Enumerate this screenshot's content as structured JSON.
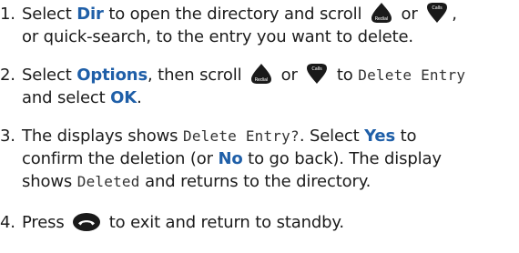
{
  "steps": [
    {
      "number": "1.",
      "text_1": "Select ",
      "key_dir": "Dir",
      "text_2": " to open the directory and scroll ",
      "text_3": " or ",
      "text_4": ",",
      "text_5": "or quick-search, to the entry you want to delete."
    },
    {
      "number": "2.",
      "text_1": "Select ",
      "key_options": "Options",
      "text_2": ", then scroll ",
      "text_3": " or ",
      "text_4": " to ",
      "lcd_delete_entry": "Delete Entry",
      "text_5": "and select ",
      "key_ok": "OK",
      "text_6": "."
    },
    {
      "number": "3.",
      "text_1": "The displays shows ",
      "lcd_delete_entry_q": "Delete Entry?",
      "text_2": ". Select ",
      "key_yes": "Yes",
      "text_3": " to",
      "text_4": "confirm the deletion (or ",
      "key_no": "No",
      "text_5": " to go back). The display",
      "text_6": "shows ",
      "lcd_deleted": "Deleted",
      "text_7": " and returns to the directory."
    },
    {
      "number": "4.",
      "text_1": "Press ",
      "text_2": " to exit and return to standby."
    }
  ],
  "icons": {
    "up_key": "redial-up-icon",
    "up_key_label": "Redial",
    "down_key": "calls-down-icon",
    "down_key_label": "Calls",
    "end_key": "end-call-icon"
  },
  "colors": {
    "keyword": "#1f5fa8",
    "text": "#1c1c1c"
  }
}
